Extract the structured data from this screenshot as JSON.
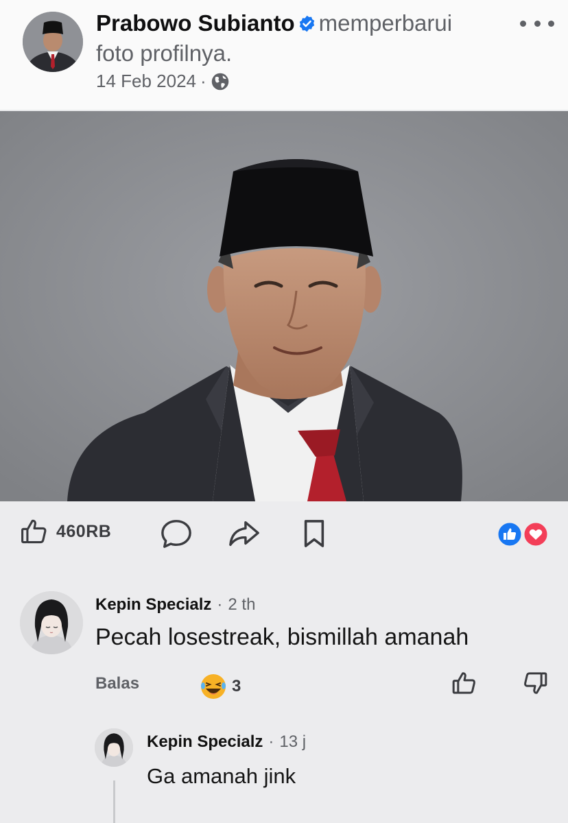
{
  "post": {
    "author": "Prabowo Subianto",
    "action": "memperbarui foto profilnya.",
    "date": "14 Feb 2024",
    "separator": "·"
  },
  "actions": {
    "like_count": "460RB"
  },
  "comments": [
    {
      "name": "Kepin Specialz",
      "time": "2 th",
      "text": "Pecah losestreak, bismillah amanah",
      "reply_label": "Balas",
      "reaction_count": "3"
    },
    {
      "name": "Kepin Specialz",
      "time": "13 j",
      "text": "Ga amanah jink"
    }
  ],
  "icons": {
    "verified": "verified-badge-icon",
    "more": "more-options-icon",
    "audience": "globe-icon",
    "like": "thumbs-up-icon",
    "comment": "comment-bubble-icon",
    "share": "share-arrow-icon",
    "save": "bookmark-icon",
    "reactions": [
      "like-reaction-icon",
      "love-reaction-icon"
    ],
    "comment_reaction": "laughing-emoji-icon",
    "dislike": "thumbs-down-icon"
  },
  "colors": {
    "verified_blue": "#1877f2",
    "love_red": "#f33e58",
    "tie_red": "#b3202c"
  }
}
